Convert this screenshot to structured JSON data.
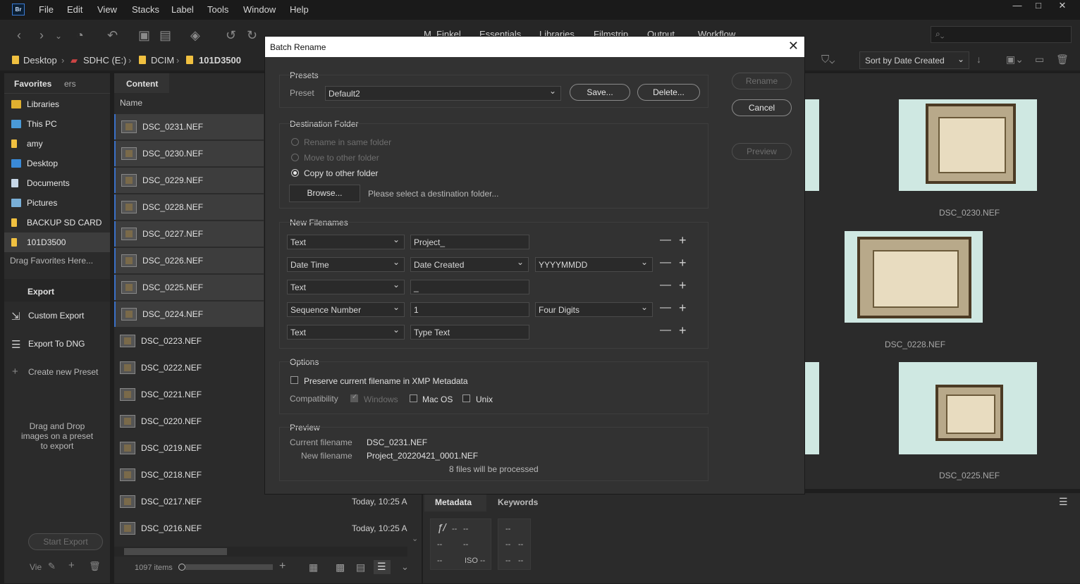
{
  "app": {
    "logo": "Br"
  },
  "menu": [
    "File",
    "Edit",
    "View",
    "Stacks",
    "Label",
    "Tools",
    "Window",
    "Help"
  ],
  "workspaces": [
    "M_Finkel",
    "Essentials",
    "Libraries",
    "Filmstrip",
    "Output",
    "Workflow"
  ],
  "path": [
    "Desktop",
    "SDHC (E:)",
    "DCIM",
    "101D3500"
  ],
  "sort": {
    "label": "Sort by Date Created"
  },
  "left_panel": {
    "tabs": [
      "Favorites",
      "ers"
    ],
    "favorites": [
      "Libraries",
      "This PC",
      "amy",
      "Desktop",
      "Documents",
      "Pictures",
      "BACKUP SD CARD",
      "101D3500"
    ],
    "drag_hint": "Drag Favorites Here...",
    "export_tab": "Export",
    "export_items": [
      "Custom Export",
      "Export To DNG",
      "Create new Preset"
    ],
    "export_hint": "Drag and Drop images on a preset to export",
    "start_export": "Start Export",
    "footer_label": "Vie"
  },
  "content": {
    "tab": "Content",
    "column_name": "Name",
    "files": [
      {
        "name": "DSC_0231.NEF",
        "date": ""
      },
      {
        "name": "DSC_0230.NEF",
        "date": ""
      },
      {
        "name": "DSC_0229.NEF",
        "date": ""
      },
      {
        "name": "DSC_0228.NEF",
        "date": ""
      },
      {
        "name": "DSC_0227.NEF",
        "date": ""
      },
      {
        "name": "DSC_0226.NEF",
        "date": ""
      },
      {
        "name": "DSC_0225.NEF",
        "date": ""
      },
      {
        "name": "DSC_0224.NEF",
        "date": ""
      },
      {
        "name": "DSC_0223.NEF",
        "date": ""
      },
      {
        "name": "DSC_0222.NEF",
        "date": ""
      },
      {
        "name": "DSC_0221.NEF",
        "date": ""
      },
      {
        "name": "DSC_0220.NEF",
        "date": ""
      },
      {
        "name": "DSC_0219.NEF",
        "date": ""
      },
      {
        "name": "DSC_0218.NEF",
        "date": ""
      },
      {
        "name": "DSC_0217.NEF",
        "date": "Today, 10:25 A"
      },
      {
        "name": "DSC_0216.NEF",
        "date": "Today, 10:25 A"
      }
    ],
    "item_count": "1097 items"
  },
  "thumbnails": {
    "labels": [
      "DSC_0230.NEF",
      "DSC_0228.NEF",
      "DSC_0225.NEF"
    ]
  },
  "meta_panel": {
    "tabs": [
      "Metadata",
      "Keywords"
    ],
    "f_symbol": "ƒ/",
    "dash": "--",
    "iso": "ISO --"
  },
  "dialog": {
    "title": "Batch Rename",
    "buttons": {
      "rename": "Rename",
      "cancel": "Cancel",
      "preview": "Preview"
    },
    "presets": {
      "heading": "Presets",
      "label": "Preset",
      "value": "Default2",
      "save": "Save...",
      "delete": "Delete..."
    },
    "destination": {
      "heading": "Destination Folder",
      "options": [
        "Rename in same folder",
        "Move to other folder",
        "Copy to other folder"
      ],
      "browse": "Browse...",
      "placeholder": "Please select a destination folder..."
    },
    "new_filenames": {
      "heading": "New Filenames",
      "rows": [
        {
          "type": "Text",
          "value": "Project_",
          "format": ""
        },
        {
          "type": "Date Time",
          "value": "Date Created",
          "format": "YYYYMMDD"
        },
        {
          "type": "Text",
          "value": "_",
          "format": ""
        },
        {
          "type": "Sequence Number",
          "value": "1",
          "format": "Four Digits"
        },
        {
          "type": "Text",
          "value": "Type Text",
          "format": ""
        }
      ],
      "minus": "—",
      "plus": "+"
    },
    "options": {
      "heading": "Options",
      "preserve": "Preserve current filename in XMP Metadata",
      "compat_label": "Compatibility",
      "compat": [
        "Windows",
        "Mac OS",
        "Unix"
      ]
    },
    "preview": {
      "heading": "Preview",
      "current_label": "Current filename",
      "current": "DSC_0231.NEF",
      "new_label": "New filename",
      "new": "Project_20220421_0001.NEF",
      "count": "8 files will be processed"
    }
  },
  "colors": {
    "accent": "#3a70c8",
    "background": "#1e1e1e",
    "panel": "#2b2b2b",
    "dialog": "#323232"
  }
}
